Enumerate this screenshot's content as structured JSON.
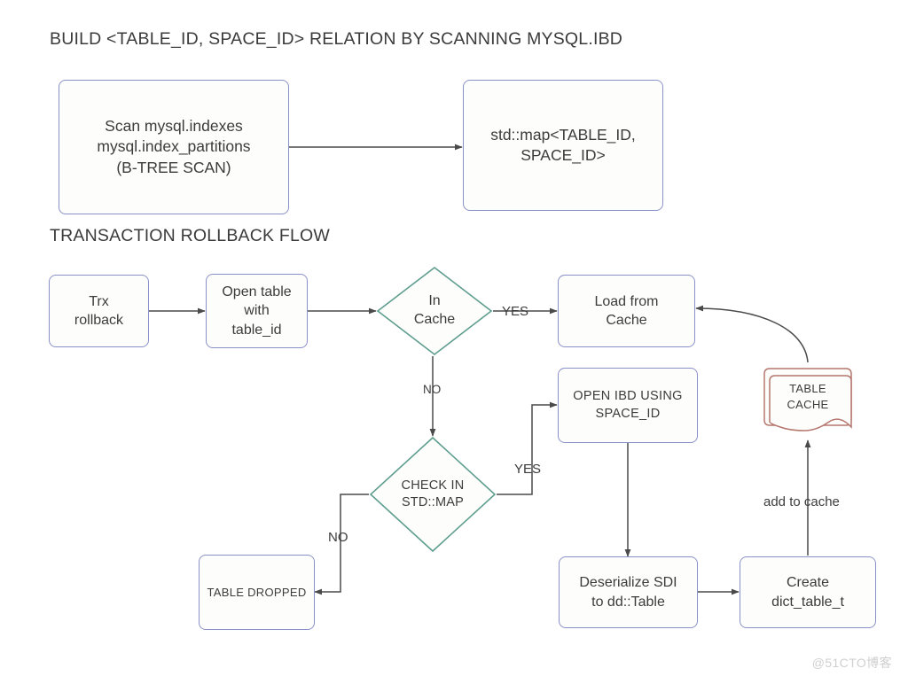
{
  "sections": {
    "build_title": "BUILD <TABLE_ID, SPACE_ID> RELATION BY SCANNING MYSQL.IBD",
    "rollback_title": "TRANSACTION ROLLBACK FLOW"
  },
  "nodes": {
    "scan_indexes": "Scan mysql.indexes\nmysql.index_partitions\n(B-TREE SCAN)",
    "std_map": "std::map<TABLE_ID,\nSPACE_ID>",
    "trx_rollback": "Trx\nrollback",
    "open_table": "Open table\nwith\ntable_id",
    "in_cache": "In\nCache",
    "load_from_cache": "Load from\nCache",
    "check_in_map": "CHECK IN\nSTD::MAP",
    "open_ibd": "OPEN IBD USING\nSPACE_ID",
    "table_cache": "TABLE\nCACHE",
    "table_dropped": "TABLE DROPPED",
    "deserialize_sdi": "Deserialize SDI\nto dd::Table",
    "create_dict_table": "Create\ndict_table_t"
  },
  "edge_labels": {
    "yes_in_cache": "YES",
    "no_in_cache": "NO",
    "yes_check_map": "YES",
    "no_check_map": "NO",
    "add_to_cache": "add to cache"
  },
  "colors": {
    "box_border": "#8a90c8",
    "diamond_border": "#5f9e8f",
    "document_border": "#b5776e",
    "arrow": "#4a4a4a",
    "text": "#3c3c3c",
    "background": "#ffffff",
    "watermark": "#cfcfcf"
  },
  "watermark": "@51CTO博客"
}
